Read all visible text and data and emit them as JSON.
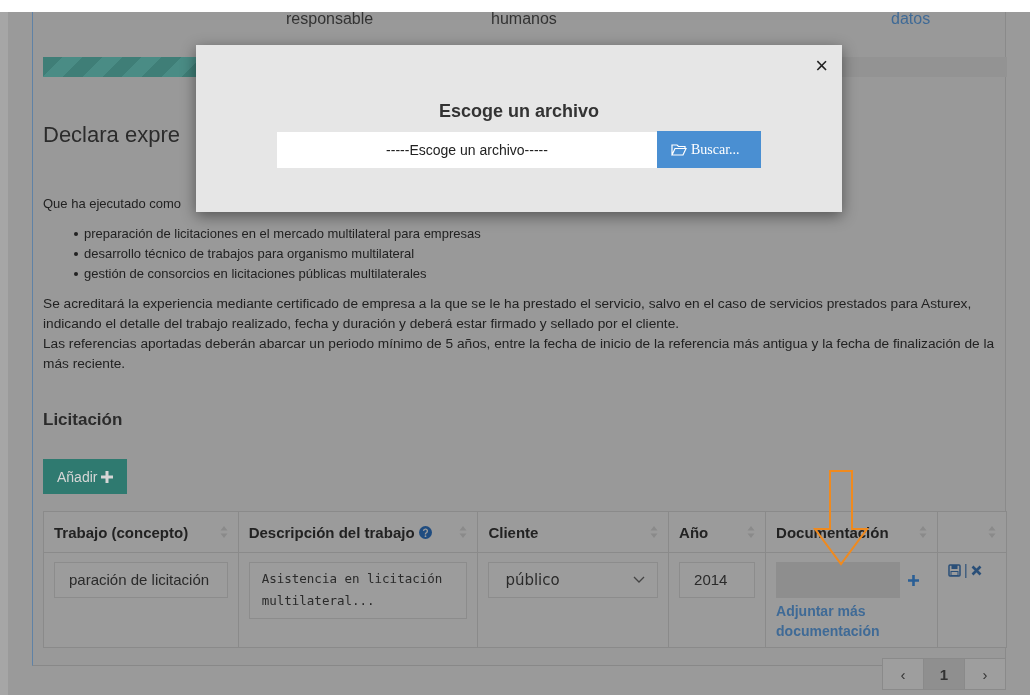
{
  "top_row": [
    {
      "text": "responsable",
      "kind": "text"
    },
    {
      "text": "humanos",
      "kind": "text"
    },
    {
      "text": "datos",
      "kind": "link"
    }
  ],
  "progress": {
    "level": 0.16
  },
  "heading": "Declara expre",
  "intro": "Que ha ejecutado como",
  "bullets": [
    "preparación de licitaciones en el mercado multilateral para empresas",
    "desarrollo técnico de trabajos para organismo multilateral",
    "gestión de consorcios en licitaciones públicas multilaterales"
  ],
  "paragraphs": [
    "Se acreditará la experiencia mediante certificado de empresa a la que se le ha prestado el servicio, salvo en el caso de servicios prestados para Asturex, indicando el detalle del trabajo realizado, fecha y duración y deberá estar firmado y sellado por el cliente.",
    "Las referencias aportadas deberán abarcar un periodo mínimo de 5 años, entre la fecha de inicio de la referencia más antigua y la fecha de finalización de la más reciente."
  ],
  "section_title": "Licitación",
  "add_button": "Añadir",
  "table": {
    "columns": [
      {
        "label": "Trabajo (concepto)",
        "help": false
      },
      {
        "label": "Descripción del trabajo",
        "help": true
      },
      {
        "label": "Cliente",
        "help": false
      },
      {
        "label": "Año",
        "help": false
      },
      {
        "label": "Documentación",
        "help": false
      },
      {
        "help": false
      }
    ],
    "rows": [
      {
        "concepto": "paración de licitación",
        "descripcion": "Asistencia en licitación multilateral...",
        "cliente": "público",
        "anio": "2014",
        "attach_link": "Adjuntar más documentación",
        "separator": "|"
      }
    ]
  },
  "pagination": {
    "prev": "‹",
    "pages": [
      {
        "label": "1",
        "selected": true
      }
    ],
    "next": "›"
  },
  "modal": {
    "title": "Escoge un archivo",
    "file_value": "-----Escoge un archivo-----",
    "browse_button": "Buscar...",
    "close": "×"
  }
}
